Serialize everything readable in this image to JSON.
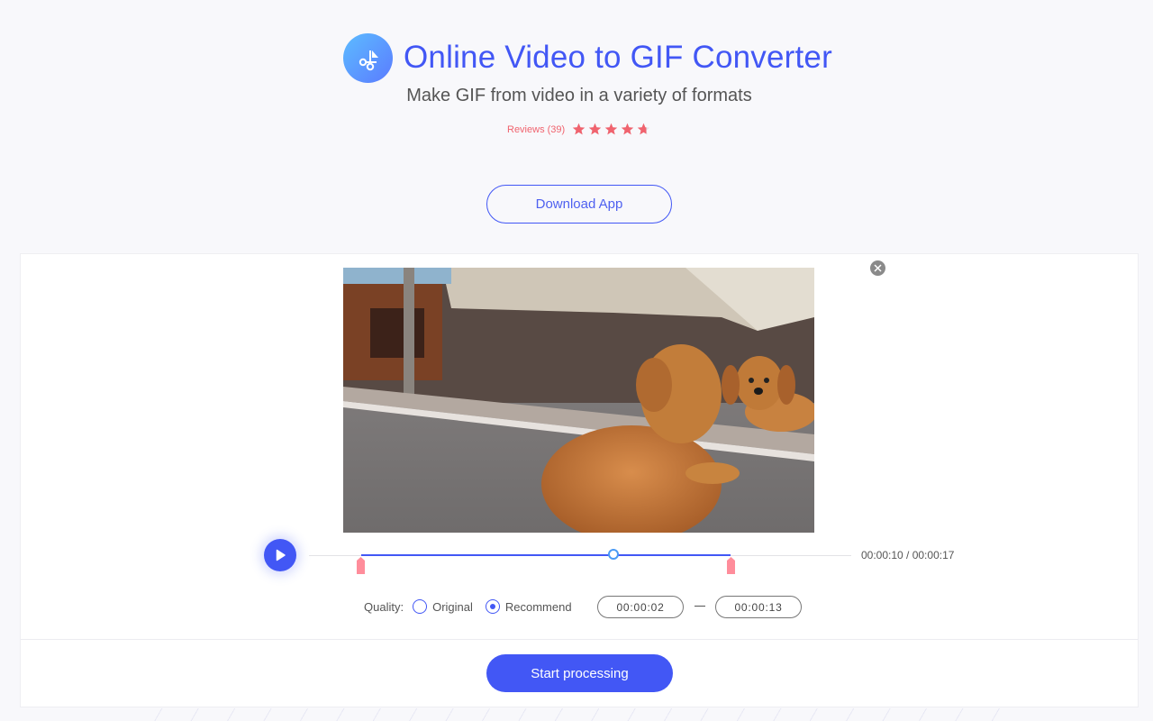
{
  "header": {
    "title": "Online Video to GIF Converter",
    "subtitle": "Make GIF from video in a variety of formats",
    "reviews_label": "Reviews (39)",
    "rating": 4.7,
    "rating_max": 5,
    "logo_icon": "scissors-cut-icon"
  },
  "download_button": {
    "label": "Download App"
  },
  "editor": {
    "close_icon": "close-icon",
    "video": {
      "description": "Puppy looking at its reflection in a mirror"
    },
    "player": {
      "play_icon": "play-icon",
      "current_time": "00:00:10",
      "total_time": "00:00:17",
      "time_readout": "00:00:10 / 00:00:17",
      "playhead_fraction": 0.588,
      "range_start_fraction": 0.118,
      "range_end_fraction": 0.765
    },
    "quality": {
      "label": "Quality:",
      "options": [
        {
          "label": "Original",
          "selected": false
        },
        {
          "label": "Recommend",
          "selected": true
        }
      ]
    },
    "trim": {
      "start": "00:00:02",
      "end": "00:00:13"
    },
    "start_button": {
      "label": "Start processing"
    }
  },
  "colors": {
    "accent": "#4257f5",
    "rating": "#f0636e",
    "handle": "#ff8d9b",
    "playhead": "#4a9af5"
  }
}
